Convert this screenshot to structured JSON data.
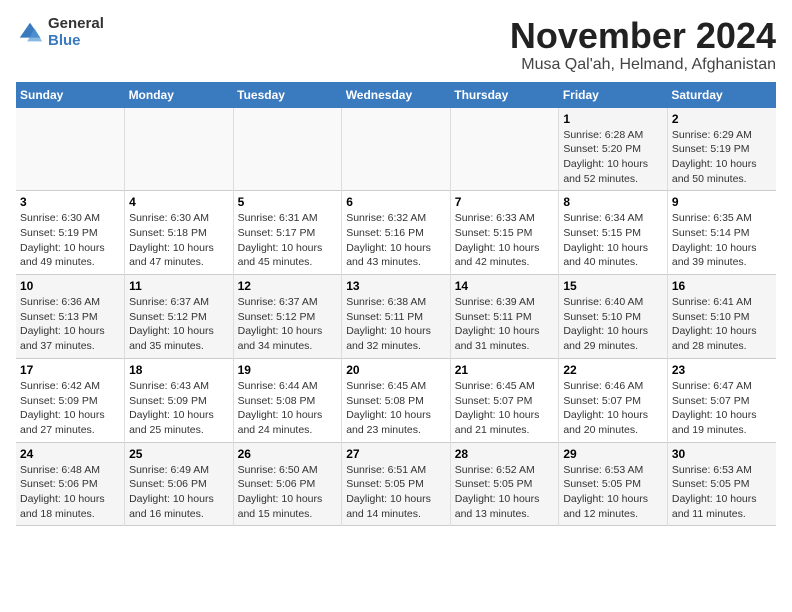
{
  "header": {
    "logo_general": "General",
    "logo_blue": "Blue",
    "month": "November 2024",
    "location": "Musa Qal'ah, Helmand, Afghanistan"
  },
  "weekdays": [
    "Sunday",
    "Monday",
    "Tuesday",
    "Wednesday",
    "Thursday",
    "Friday",
    "Saturday"
  ],
  "weeks": [
    [
      {
        "day": "",
        "info": ""
      },
      {
        "day": "",
        "info": ""
      },
      {
        "day": "",
        "info": ""
      },
      {
        "day": "",
        "info": ""
      },
      {
        "day": "",
        "info": ""
      },
      {
        "day": "1",
        "info": "Sunrise: 6:28 AM\nSunset: 5:20 PM\nDaylight: 10 hours and 52 minutes."
      },
      {
        "day": "2",
        "info": "Sunrise: 6:29 AM\nSunset: 5:19 PM\nDaylight: 10 hours and 50 minutes."
      }
    ],
    [
      {
        "day": "3",
        "info": "Sunrise: 6:30 AM\nSunset: 5:19 PM\nDaylight: 10 hours and 49 minutes."
      },
      {
        "day": "4",
        "info": "Sunrise: 6:30 AM\nSunset: 5:18 PM\nDaylight: 10 hours and 47 minutes."
      },
      {
        "day": "5",
        "info": "Sunrise: 6:31 AM\nSunset: 5:17 PM\nDaylight: 10 hours and 45 minutes."
      },
      {
        "day": "6",
        "info": "Sunrise: 6:32 AM\nSunset: 5:16 PM\nDaylight: 10 hours and 43 minutes."
      },
      {
        "day": "7",
        "info": "Sunrise: 6:33 AM\nSunset: 5:15 PM\nDaylight: 10 hours and 42 minutes."
      },
      {
        "day": "8",
        "info": "Sunrise: 6:34 AM\nSunset: 5:15 PM\nDaylight: 10 hours and 40 minutes."
      },
      {
        "day": "9",
        "info": "Sunrise: 6:35 AM\nSunset: 5:14 PM\nDaylight: 10 hours and 39 minutes."
      }
    ],
    [
      {
        "day": "10",
        "info": "Sunrise: 6:36 AM\nSunset: 5:13 PM\nDaylight: 10 hours and 37 minutes."
      },
      {
        "day": "11",
        "info": "Sunrise: 6:37 AM\nSunset: 5:12 PM\nDaylight: 10 hours and 35 minutes."
      },
      {
        "day": "12",
        "info": "Sunrise: 6:37 AM\nSunset: 5:12 PM\nDaylight: 10 hours and 34 minutes."
      },
      {
        "day": "13",
        "info": "Sunrise: 6:38 AM\nSunset: 5:11 PM\nDaylight: 10 hours and 32 minutes."
      },
      {
        "day": "14",
        "info": "Sunrise: 6:39 AM\nSunset: 5:11 PM\nDaylight: 10 hours and 31 minutes."
      },
      {
        "day": "15",
        "info": "Sunrise: 6:40 AM\nSunset: 5:10 PM\nDaylight: 10 hours and 29 minutes."
      },
      {
        "day": "16",
        "info": "Sunrise: 6:41 AM\nSunset: 5:10 PM\nDaylight: 10 hours and 28 minutes."
      }
    ],
    [
      {
        "day": "17",
        "info": "Sunrise: 6:42 AM\nSunset: 5:09 PM\nDaylight: 10 hours and 27 minutes."
      },
      {
        "day": "18",
        "info": "Sunrise: 6:43 AM\nSunset: 5:09 PM\nDaylight: 10 hours and 25 minutes."
      },
      {
        "day": "19",
        "info": "Sunrise: 6:44 AM\nSunset: 5:08 PM\nDaylight: 10 hours and 24 minutes."
      },
      {
        "day": "20",
        "info": "Sunrise: 6:45 AM\nSunset: 5:08 PM\nDaylight: 10 hours and 23 minutes."
      },
      {
        "day": "21",
        "info": "Sunrise: 6:45 AM\nSunset: 5:07 PM\nDaylight: 10 hours and 21 minutes."
      },
      {
        "day": "22",
        "info": "Sunrise: 6:46 AM\nSunset: 5:07 PM\nDaylight: 10 hours and 20 minutes."
      },
      {
        "day": "23",
        "info": "Sunrise: 6:47 AM\nSunset: 5:07 PM\nDaylight: 10 hours and 19 minutes."
      }
    ],
    [
      {
        "day": "24",
        "info": "Sunrise: 6:48 AM\nSunset: 5:06 PM\nDaylight: 10 hours and 18 minutes."
      },
      {
        "day": "25",
        "info": "Sunrise: 6:49 AM\nSunset: 5:06 PM\nDaylight: 10 hours and 16 minutes."
      },
      {
        "day": "26",
        "info": "Sunrise: 6:50 AM\nSunset: 5:06 PM\nDaylight: 10 hours and 15 minutes."
      },
      {
        "day": "27",
        "info": "Sunrise: 6:51 AM\nSunset: 5:05 PM\nDaylight: 10 hours and 14 minutes."
      },
      {
        "day": "28",
        "info": "Sunrise: 6:52 AM\nSunset: 5:05 PM\nDaylight: 10 hours and 13 minutes."
      },
      {
        "day": "29",
        "info": "Sunrise: 6:53 AM\nSunset: 5:05 PM\nDaylight: 10 hours and 12 minutes."
      },
      {
        "day": "30",
        "info": "Sunrise: 6:53 AM\nSunset: 5:05 PM\nDaylight: 10 hours and 11 minutes."
      }
    ]
  ]
}
